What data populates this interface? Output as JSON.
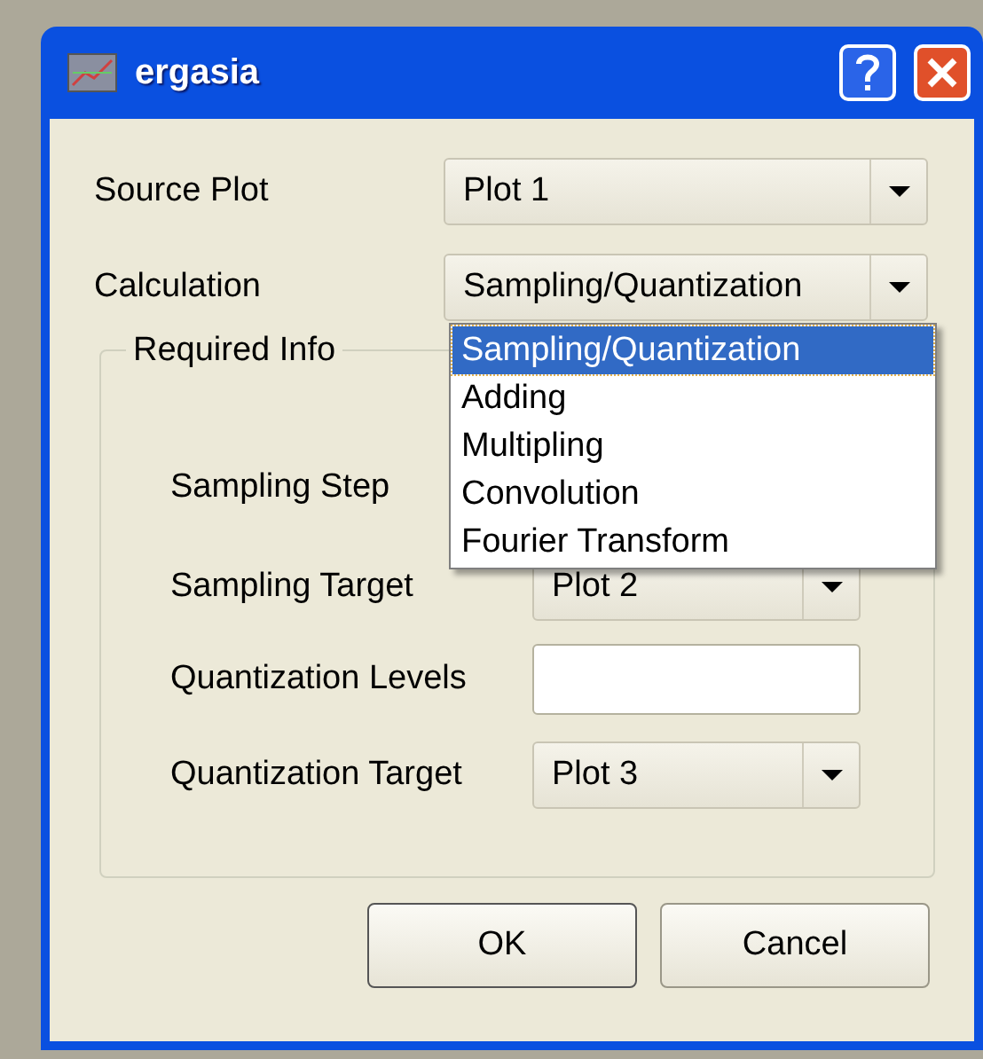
{
  "window": {
    "title": "ergasia"
  },
  "fields": [
    {
      "label": "Source Plot",
      "kind": "combo",
      "value": "Plot 1"
    },
    {
      "label": "Calculation",
      "kind": "combo",
      "value": "Sampling/Quantization",
      "expanded": true
    }
  ],
  "dropdown_options": [
    {
      "label": "Sampling/Quantization",
      "selected": true
    },
    {
      "label": "Adding",
      "selected": false
    },
    {
      "label": "Multipling",
      "selected": false
    },
    {
      "label": "Convolution",
      "selected": false
    },
    {
      "label": "Fourier Transform",
      "selected": false
    }
  ],
  "group": {
    "title": "Required Info",
    "fields": [
      {
        "label": "Sampling Step",
        "kind": "hidden"
      },
      {
        "label": "Sampling Target",
        "kind": "combo",
        "value": "Plot 2"
      },
      {
        "label": "Quantization Levels",
        "kind": "text"
      },
      {
        "label": "Quantization Target",
        "kind": "combo",
        "value": "Plot 3"
      }
    ]
  },
  "buttons": [
    {
      "label": "OK",
      "kind": "default"
    },
    {
      "label": "Cancel",
      "kind": "normal"
    }
  ]
}
